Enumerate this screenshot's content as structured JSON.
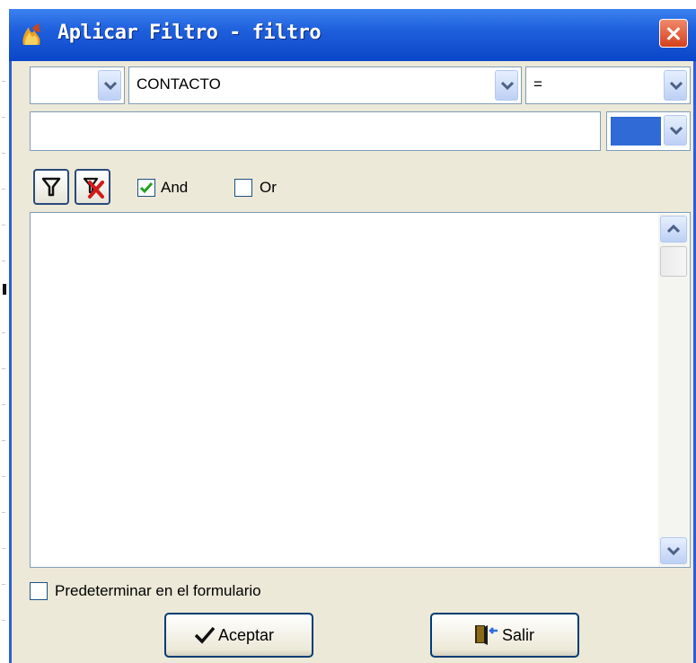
{
  "window": {
    "title": "Aplicar Filtro - filtro"
  },
  "filter_row": {
    "prefix_value": "",
    "field_value": "CONTACTO",
    "operator_value": "="
  },
  "value_row": {
    "value": "",
    "color_swatch": "#2f6ad6"
  },
  "toolbar": {
    "add_filter_icon": "funnel-icon",
    "remove_filter_icon": "funnel-remove-icon"
  },
  "logic": {
    "and_label": "And",
    "and_checked": true,
    "or_label": "Or",
    "or_checked": false
  },
  "criteria_list": {
    "items": []
  },
  "default_option": {
    "label": "Predeterminar en el formulario",
    "checked": false
  },
  "buttons": {
    "accept_label": "Aceptar",
    "exit_label": "Salir"
  },
  "colors": {
    "titlebar": "#0a46c8",
    "client_bg": "#ece9d8",
    "check_mark": "#21a121",
    "field_border": "#7f9db9"
  }
}
